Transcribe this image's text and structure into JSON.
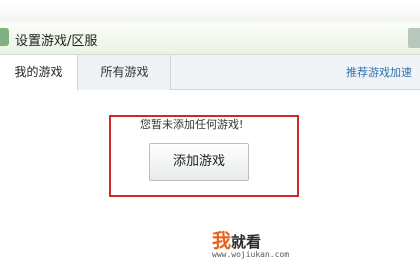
{
  "window": {
    "title": "设置游戏/区服"
  },
  "tabs": [
    {
      "label": "我的游戏",
      "active": true
    },
    {
      "label": "所有游戏",
      "active": false
    }
  ],
  "header_link": {
    "label": "推荐游戏加速"
  },
  "main": {
    "empty_message": "您暂未添加任何游戏!",
    "add_button_label": "添加游戏"
  },
  "watermark": {
    "brand_first": "我",
    "brand_rest": "就看",
    "url": "www.wojiukan.com"
  },
  "colors": {
    "highlight_border": "#cc2a2a",
    "link": "#2f72b4",
    "titlebar_tint": "#e9f2e2",
    "watermark_accent": "#e8631a"
  },
  "icons": {
    "app": "app-icon"
  }
}
